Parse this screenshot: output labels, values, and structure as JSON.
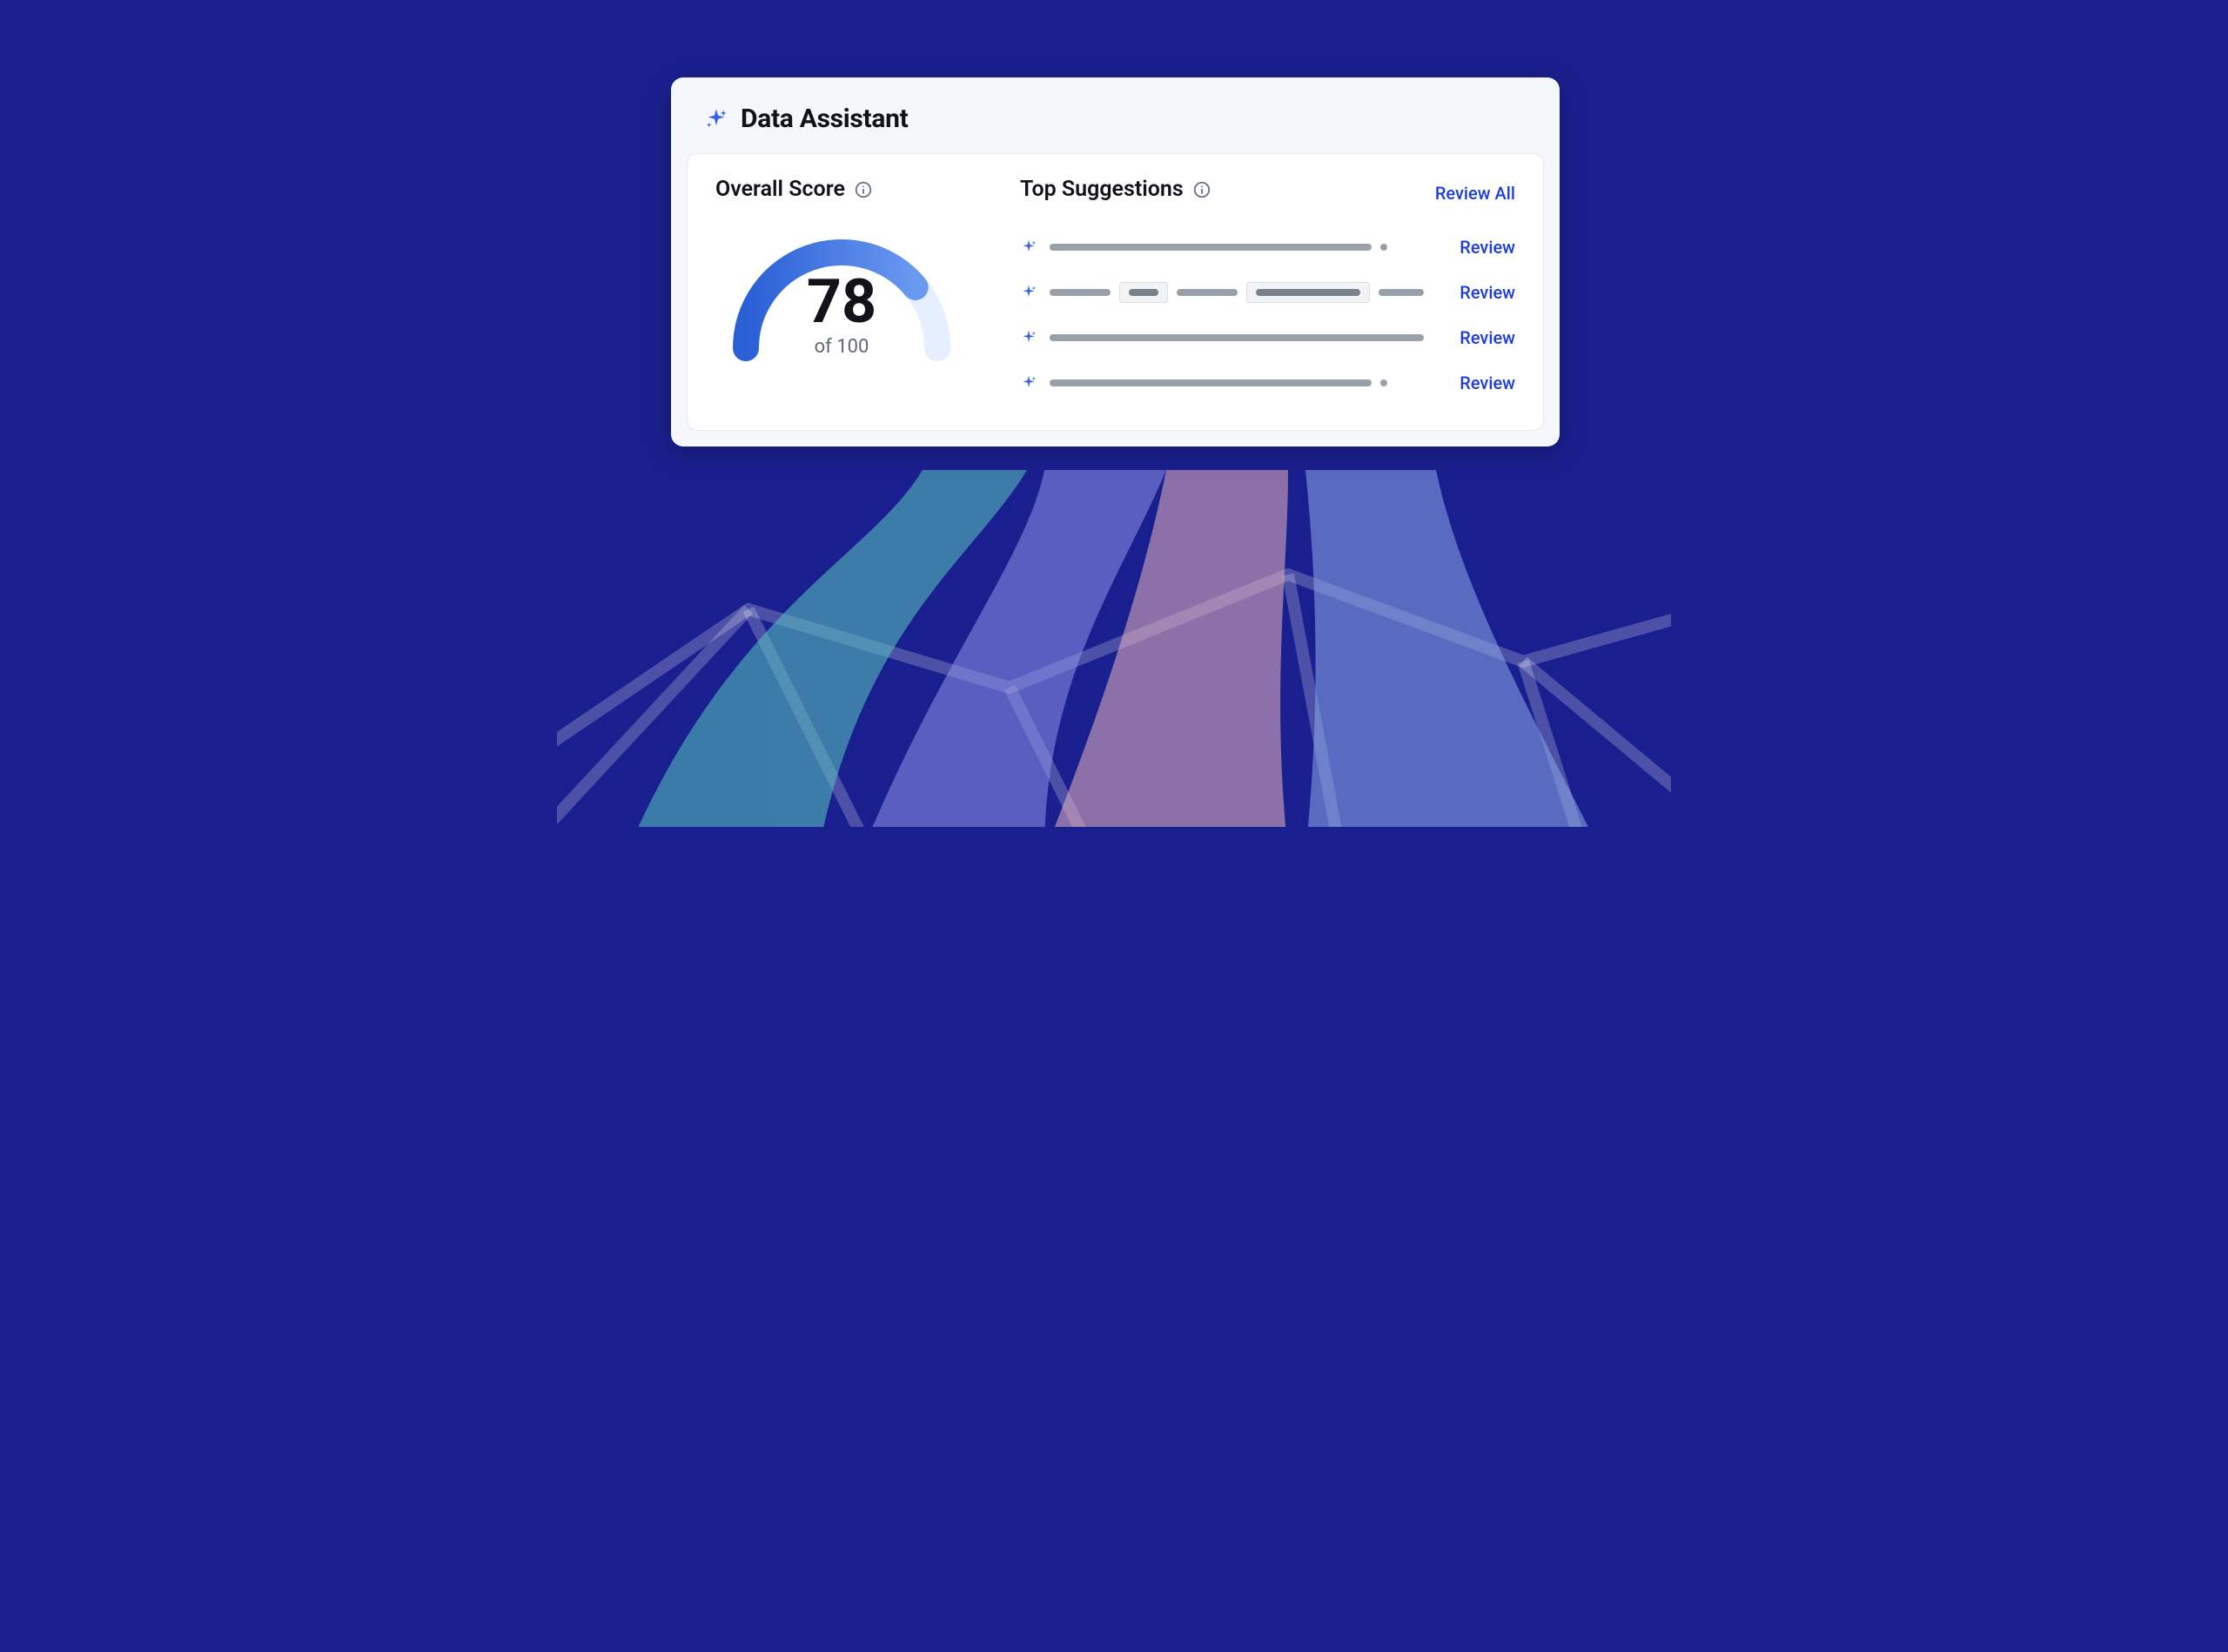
{
  "card": {
    "title": "Data Assistant",
    "score_section_label": "Overall Score",
    "score_value": "78",
    "score_of": "of 100",
    "score_fraction": 0.78,
    "suggestions_section_label": "Top Suggestions",
    "review_all_label": "Review All",
    "review_label": "Review"
  },
  "colors": {
    "gauge_track": "#e6efff",
    "gauge_fill_start": "#2a5fd6",
    "gauge_fill_end": "#6a99f0",
    "link": "#1e3dd8",
    "sparkle": "#3a62e6"
  }
}
